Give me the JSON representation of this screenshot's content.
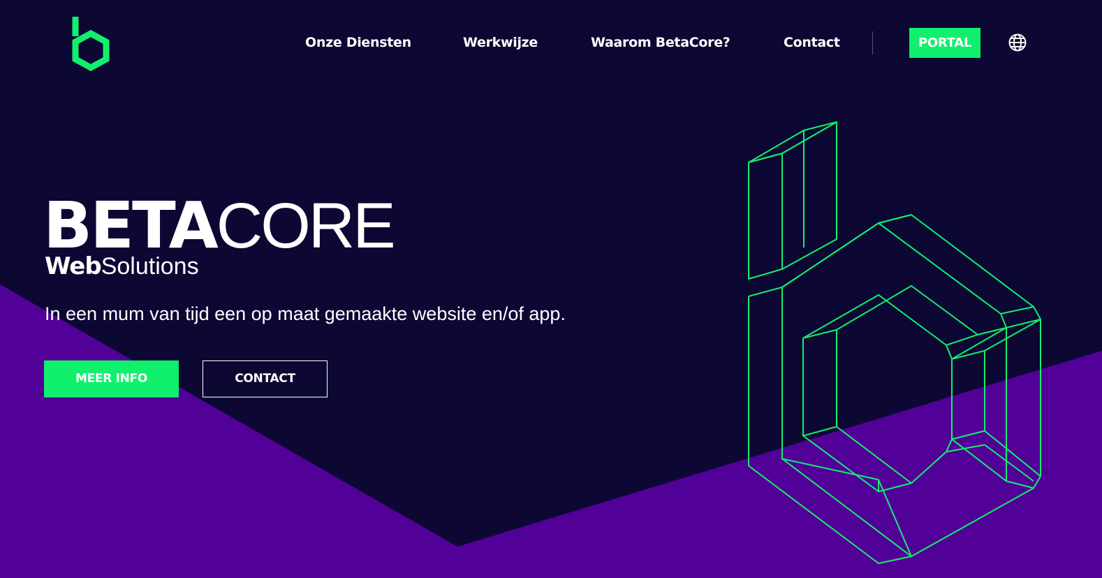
{
  "colors": {
    "background": "#0c0833",
    "purple_band": "#520198",
    "accent_green": "#10f06d",
    "text": "#ffffff"
  },
  "header": {
    "logo_icon": "betacore-b-hexagon-icon",
    "nav": [
      {
        "label": "Onze Diensten"
      },
      {
        "label": "Werkwijze"
      },
      {
        "label": "Waarom BetaCore?"
      },
      {
        "label": "Contact"
      }
    ],
    "portal_label": "PORTAL",
    "language_icon": "globe-icon"
  },
  "hero": {
    "title_bold": "BETA",
    "title_thin": "CORE",
    "subtitle_bold": "Web",
    "subtitle_thin": "Solutions",
    "tagline": "In een mum van tijd een op maat gemaakte website en/of app.",
    "primary_button": "MEER INFO",
    "secondary_button": "CONTACT",
    "illustration_icon": "wireframe-b-hexagon-3d-icon"
  }
}
